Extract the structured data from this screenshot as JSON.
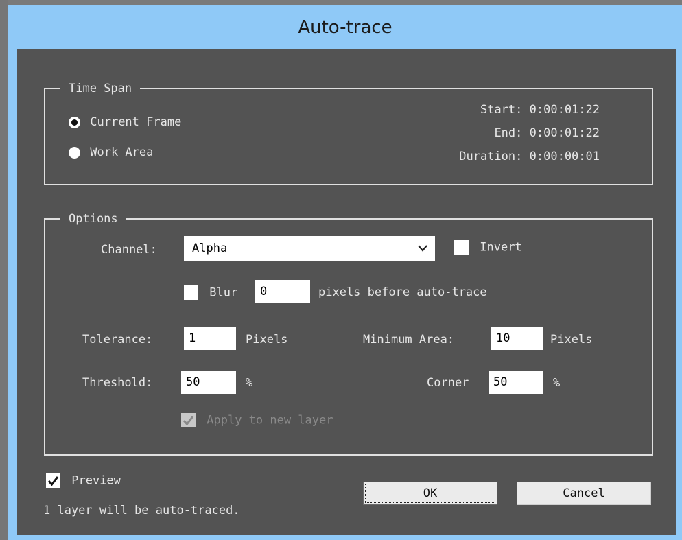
{
  "window": {
    "title": "Auto-trace"
  },
  "time_span": {
    "legend": "Time Span",
    "options": [
      {
        "label": "Current Frame",
        "selected": true
      },
      {
        "label": "Work Area",
        "selected": false
      }
    ],
    "start_label": "Start:",
    "start_value": "0:00:01:22",
    "end_label": "End:",
    "end_value": "0:00:01:22",
    "duration_label": "Duration:",
    "duration_value": "0:00:00:01"
  },
  "options": {
    "legend": "Options",
    "channel_label": "Channel:",
    "channel_value": "Alpha",
    "invert_label": "Invert",
    "invert_checked": false,
    "blur_label": "Blur",
    "blur_checked": false,
    "blur_value": "0",
    "blur_suffix": "pixels before auto-trace",
    "tolerance_label": "Tolerance:",
    "tolerance_value": "1",
    "tolerance_unit": "Pixels",
    "min_area_label": "Minimum Area:",
    "min_area_value": "10",
    "min_area_unit": "Pixels",
    "threshold_label": "Threshold:",
    "threshold_value": "50",
    "threshold_unit": "%",
    "corner_label": "Corner",
    "corner_value": "50",
    "corner_unit": "%",
    "apply_label": "Apply to new layer",
    "apply_checked": true
  },
  "footer": {
    "preview_label": "Preview",
    "preview_checked": true,
    "status": "1 layer will be auto-traced.",
    "ok_label": "OK",
    "cancel_label": "Cancel"
  },
  "colors": {
    "title_bar": "#8fc9f7",
    "panel": "#535353",
    "text": "#e6e6e6"
  }
}
